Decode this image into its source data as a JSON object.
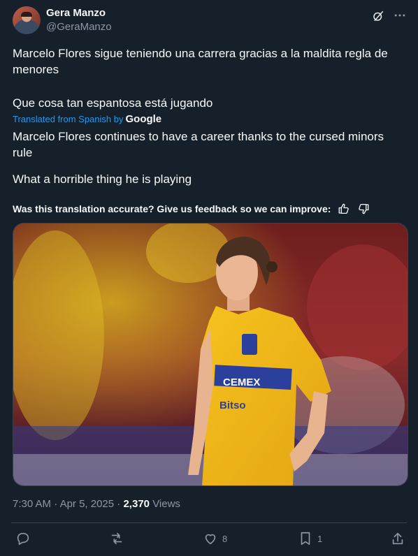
{
  "author": {
    "name": "Gera Manzo",
    "handle": "@GeraManzo"
  },
  "tweet": {
    "line1": "Marcelo Flores sigue teniendo una carrera gracias a la maldita regla de menores",
    "line2": "Que cosa tan espantosa está jugando",
    "translated_label": "Translated from Spanish by",
    "translated_by": "Google",
    "translation1": "Marcelo Flores continues to have a career thanks to the cursed minors rule",
    "translation2": "What a horrible thing he is playing",
    "feedback": "Was this translation accurate? Give us feedback so we can improve:"
  },
  "media": {
    "shirt_text": [
      "CEMEX",
      "Bitso"
    ]
  },
  "meta": {
    "time": "7:30 AM",
    "date": "Apr 5, 2025",
    "views_count": "2,370",
    "views_label": "Views"
  },
  "actions": {
    "likes": "8",
    "bookmarks": "1"
  },
  "colors": {
    "background": "#15202b",
    "accent": "#1d9bf0",
    "muted": "#8b98a5"
  }
}
